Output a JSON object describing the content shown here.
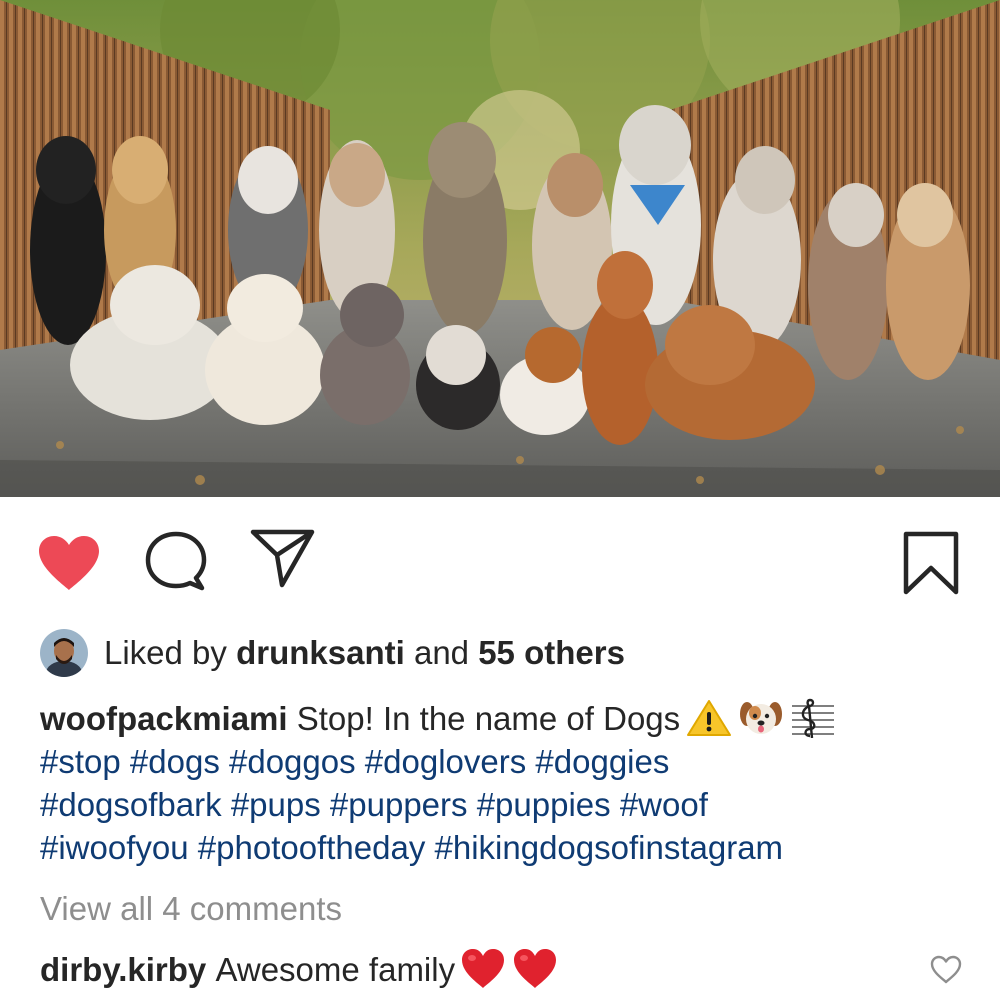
{
  "post": {
    "username": "woofpackmiami",
    "caption_text": "Stop! In the name of Dogs",
    "caption_emojis": [
      "warning-emoji",
      "dog-face-emoji",
      "musical-score-emoji"
    ],
    "hashtags": [
      [
        "#stop",
        "#dogs",
        "#doggos",
        "#doglovers",
        "#doggies"
      ],
      [
        "#dogsofbark",
        "#pups",
        "#puppers",
        "#puppies",
        "#woof"
      ],
      [
        "#iwoofyou",
        "#photooftheday",
        "#hikingdogsofinstagram"
      ]
    ]
  },
  "actions": {
    "like_icon": "heart-filled-icon",
    "comment_icon": "comment-bubble-icon",
    "share_icon": "paper-plane-icon",
    "save_icon": "bookmark-icon",
    "like_color": "#ed4956"
  },
  "likes": {
    "prefix": "Liked by",
    "user": "drunksanti",
    "conjunction": "and",
    "others": "55 others"
  },
  "comments": {
    "view_all": "View all 4 comments",
    "items": [
      {
        "username": "dirby.kirby",
        "text": "Awesome family",
        "emojis": [
          "red-heart-emoji",
          "red-heart-emoji"
        ]
      }
    ]
  },
  "colors": {
    "hashtag": "#0f3b73",
    "muted": "#8e8e8e",
    "text": "#262626"
  }
}
